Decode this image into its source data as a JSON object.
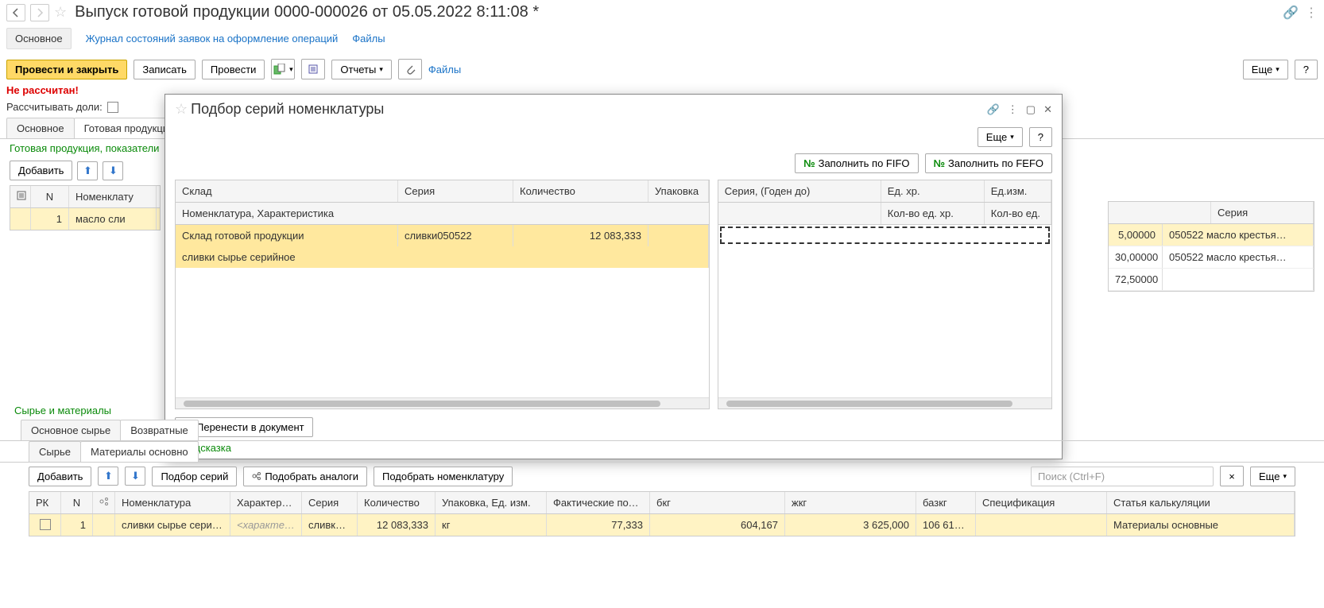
{
  "header": {
    "title": "Выпуск готовой продукции 0000-000026 от 05.05.2022 8:11:08 *"
  },
  "links": {
    "main": "Основное",
    "journal": "Журнал состояний заявок на оформление операций",
    "files": "Файлы"
  },
  "toolbar": {
    "postAndClose": "Провести и закрыть",
    "write": "Записать",
    "post": "Провести",
    "reports": "Отчеты",
    "filesLink": "Файлы",
    "more": "Еще",
    "help": "?"
  },
  "status": {
    "notCalculated": "Не рассчитан!",
    "calcLabel": "Рассчитывать доли:"
  },
  "tabs": {
    "main": "Основное",
    "products": "Готовая продукция,"
  },
  "products": {
    "sectionTitle": "Готовая продукция, показатели",
    "add": "Добавить",
    "headers": {
      "n": "N",
      "nomenclature": "Номенклату"
    },
    "row": {
      "n": "1",
      "nomenclature": "масло сли"
    }
  },
  "rightTable": {
    "h1": "",
    "h2": "Серия",
    "rows": [
      {
        "v1": "5,00000",
        "v2": "050522 масло крестья…",
        "sel": true
      },
      {
        "v1": "30,00000",
        "v2": "050522 масло крестья…",
        "sel": false
      },
      {
        "v1": "72,50000",
        "v2": "",
        "sel": false
      }
    ]
  },
  "modal": {
    "title": "Подбор серий номенклатуры",
    "more": "Еще",
    "help": "?",
    "fillFIFO": "Заполнить по FIFO",
    "fillFEFO": "Заполнить по FEFO",
    "left": {
      "headers": {
        "warehouse": "Склад",
        "series": "Серия",
        "qty": "Количество",
        "pack": "Упаковка"
      },
      "subHeader": "Номенклатура, Характеристика",
      "row1": {
        "warehouse": "Склад готовой продукции",
        "series": "сливки050522",
        "qty": "12 083,333",
        "pack": ""
      },
      "row2": "сливки сырье серийное"
    },
    "right": {
      "h1": "Серия, (Годен до)",
      "h2": "Ед. хр.",
      "h3": "Ед.изм.",
      "h4": "Кол-во ед. хр.",
      "h5": "Кол-во ед."
    },
    "transfer": "Перенести в документ",
    "hint": "Подсказка"
  },
  "materials": {
    "sectionTitle": "Сырье и материалы",
    "subTabs": {
      "mainRaw": "Основное сырье",
      "returns": "Возвратные"
    },
    "tab2": {
      "raw": "Сырье",
      "matMain": "Материалы основно"
    },
    "toolbar": {
      "add": "Добавить",
      "pickSeries": "Подбор серий",
      "pickAnalogs": "Подобрать аналоги",
      "pickNomenclature": "Подобрать номенклатуру",
      "searchPlaceholder": "Поиск (Ctrl+F)",
      "more": "Еще"
    },
    "headers": {
      "rk": "РК",
      "n": "N",
      "ic": "",
      "nom": "Номенклатура",
      "char": "Характерист…",
      "series": "Серия",
      "qty": "Количество",
      "pack": "Упаковка, Ед. изм.",
      "loss": "Фактические потери",
      "bkg": "бкг",
      "zkg": "жкг",
      "bazkg": "базкг",
      "spec": "Спецификация",
      "article": "Статья калькуляции"
    },
    "row": {
      "n": "1",
      "nom": "сливки сырье серий…",
      "char": "<характери…",
      "series": "сливки…",
      "qty": "12 083,333",
      "pack": "кг",
      "loss": "77,333",
      "bkg": "604,167",
      "zkg": "3 625,000",
      "bazkg": "106 617,…",
      "spec": "",
      "article": "Материалы основные"
    }
  }
}
